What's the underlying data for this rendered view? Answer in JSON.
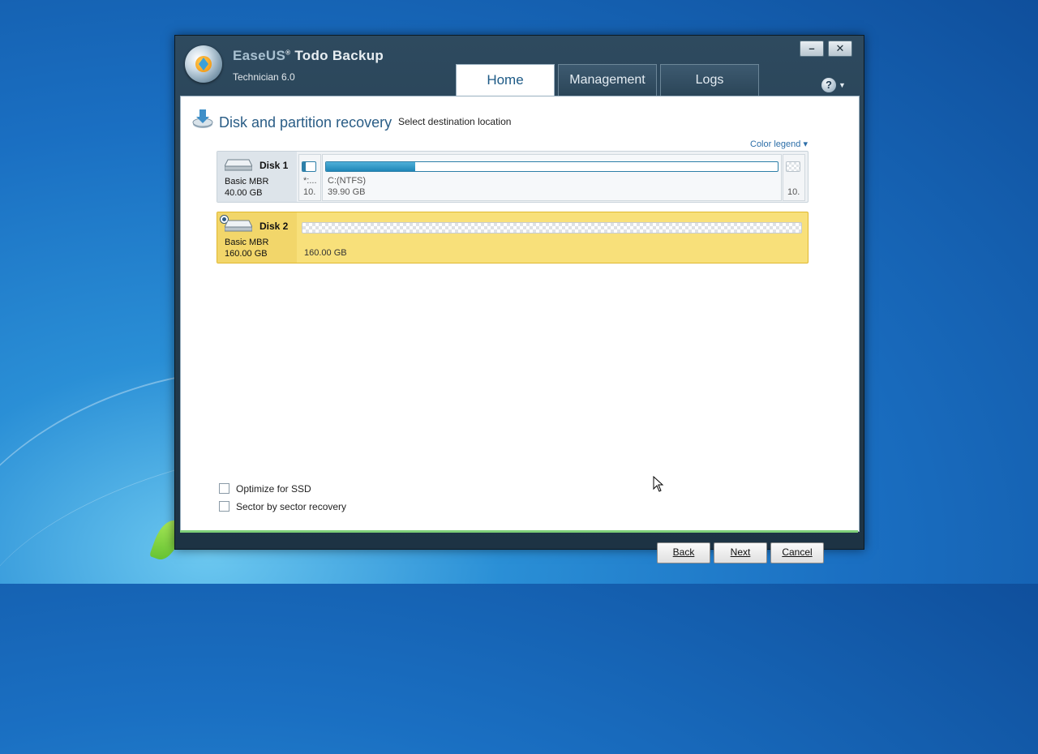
{
  "app": {
    "brand": "EaseUS",
    "registered": "®",
    "product": "Todo Backup",
    "edition": "Technician 6.0"
  },
  "window_controls": {
    "minimize": "–",
    "close": "✕"
  },
  "tabs": [
    {
      "label": "Home",
      "active": true
    },
    {
      "label": "Management",
      "active": false
    },
    {
      "label": "Logs",
      "active": false
    }
  ],
  "help": {
    "symbol": "?",
    "caret": "▼"
  },
  "page": {
    "title": "Disk and partition recovery",
    "subtitle": "Select destination location",
    "color_legend": "Color legend"
  },
  "disks": [
    {
      "name": "Disk 1",
      "type": "Basic MBR",
      "size": "40.00 GB",
      "selected": false,
      "partitions": [
        {
          "label": "*:...",
          "size": "10.",
          "used_fraction": 0.25
        },
        {
          "label": "C:(NTFS)",
          "size": "39.90 GB",
          "used_fraction": 0.197
        },
        {
          "label": "",
          "size": "10.",
          "used_fraction": 0
        }
      ]
    },
    {
      "name": "Disk 2",
      "type": "Basic MBR",
      "size": "160.00 GB",
      "selected": true,
      "unallocated_size": "160.00 GB"
    }
  ],
  "options": [
    {
      "label": "Optimize for SSD",
      "checked": false
    },
    {
      "label": "Sector by sector recovery",
      "checked": false
    }
  ],
  "buttons": {
    "back": "Back",
    "next": "Next",
    "cancel": "Cancel"
  },
  "icons": {
    "logo": "easeus-logo-icon",
    "page": "disk-recovery-icon",
    "disk": "hard-disk-icon",
    "help": "help-icon",
    "cursor": "mouse-cursor-icon"
  }
}
